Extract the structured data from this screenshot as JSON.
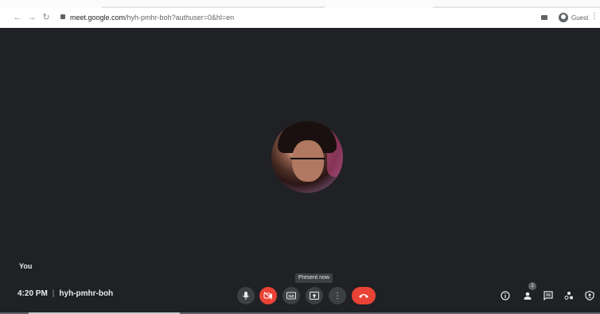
{
  "browser": {
    "url_host": "meet.google.com",
    "url_path": "/hyh-pmhr-boh?authuser=0&hl=en",
    "profile_label": "Guest"
  },
  "meeting": {
    "participant_label": "You",
    "time": "4:20 PM",
    "separator": "|",
    "code": "hyh-pmhr-boh",
    "tooltip": "Present now",
    "participants_count": "1"
  },
  "icons": {
    "back": "back-arrow-icon",
    "forward": "forward-arrow-icon",
    "reload": "reload-icon",
    "mic": "microphone-icon",
    "camera_off": "camera-off-icon",
    "captions": "captions-icon",
    "present": "present-screen-icon",
    "more": "more-options-icon",
    "hangup": "hang-up-icon",
    "info": "meeting-details-icon",
    "people": "people-icon",
    "chat": "chat-icon",
    "activities": "activities-icon",
    "host": "host-controls-icon"
  },
  "colors": {
    "background": "#202124",
    "control": "#3c4043",
    "danger": "#ea4335"
  }
}
